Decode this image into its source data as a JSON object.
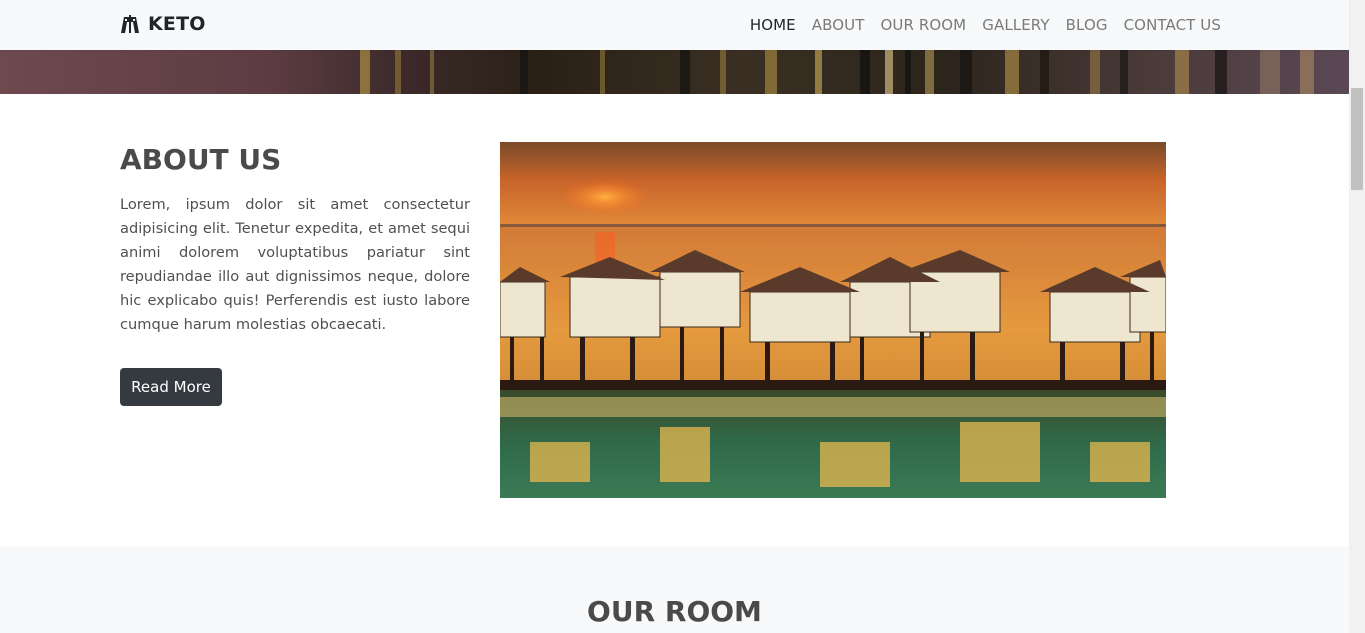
{
  "navbar": {
    "brand": "KETO",
    "brand_icon": "hotel-building-icon",
    "links": [
      {
        "label": "HOME",
        "active": true
      },
      {
        "label": "ABOUT",
        "active": false
      },
      {
        "label": "OUR ROOM",
        "active": false
      },
      {
        "label": "GALLERY",
        "active": false
      },
      {
        "label": "BLOG",
        "active": false
      },
      {
        "label": "CONTACT US",
        "active": false
      }
    ]
  },
  "about": {
    "title": "ABOUT US",
    "text": "Lorem, ipsum dolor sit amet consectetur adipisicing elit. Tenetur expedita, et amet sequi animi dolorem voluptatibus pariatur sint repudiandae illo aut dignissimos neque, dolore hic explicabo quis! Perferendis est iusto labore cumque harum molestias obcaecati.",
    "button_label": "Read More"
  },
  "rooms": {
    "title": "OUR ROOM"
  },
  "colors": {
    "navbar_bg": "#f8f9fa",
    "button_bg": "#343a40",
    "heading": "#4a4a4a",
    "section_bg": "#f8f9fa"
  }
}
